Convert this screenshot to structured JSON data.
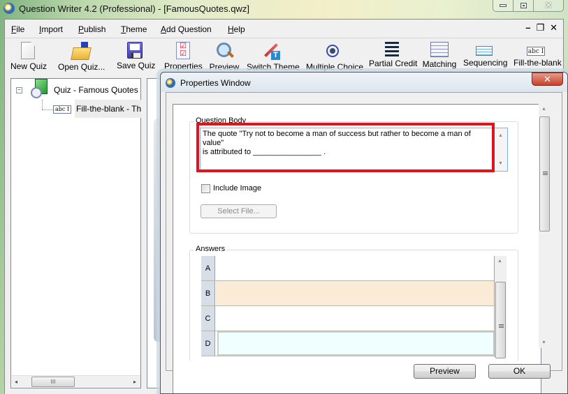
{
  "window": {
    "title": "Question Writer 4.2 (Professional) - [FamousQuotes.qwz]",
    "controls": {
      "minimize": "minimize",
      "maximize": "maximize",
      "close": "✕"
    }
  },
  "menu": [
    {
      "label": "File",
      "accel": "F",
      "rest": "ile"
    },
    {
      "label": "Import",
      "accel": "I",
      "rest": "mport"
    },
    {
      "label": "Publish",
      "accel": "P",
      "rest": "ublish"
    },
    {
      "label": "Theme",
      "accel": "T",
      "rest": "heme"
    },
    {
      "label": "Add Question",
      "accel": "A",
      "rest": "dd Question"
    },
    {
      "label": "Help",
      "accel": "H",
      "rest": "elp"
    }
  ],
  "mdi_controls": {
    "minimize": "–",
    "restore": "❐",
    "close": "✕"
  },
  "toolbar": [
    {
      "label": "New Quiz",
      "icon": "new-document-icon"
    },
    {
      "label": "Open Quiz...",
      "icon": "open-folder-icon"
    },
    {
      "label": "Save Quiz",
      "icon": "floppy-disk-icon"
    },
    {
      "label": "Properties",
      "icon": "checklist-icon"
    },
    {
      "label": "Preview",
      "icon": "magnifier-icon"
    },
    {
      "label": "Switch Theme",
      "icon": "magic-wand-icon"
    },
    {
      "label": "Multiple Choice",
      "icon": "radio-button-icon"
    },
    {
      "label": "Partial Credit",
      "icon": "list-arrows-icon"
    },
    {
      "label": "Matching",
      "icon": "grid-icon"
    },
    {
      "label": "Sequencing",
      "icon": "spinner-list-icon"
    },
    {
      "label": "Fill-the-blank",
      "icon": "text-field-icon",
      "glyph": "abc I"
    }
  ],
  "tree": {
    "root": {
      "label": "Quiz - Famous Quotes",
      "toggle": "−"
    },
    "children": [
      {
        "label": "Fill-the-blank - The quote",
        "glyph": "abc I"
      }
    ],
    "hscroll": {
      "left": "◂",
      "right": "▸",
      "grip": "III"
    }
  },
  "dialog": {
    "title": "Properties Window",
    "close": "✕",
    "question_body": {
      "legend": "Question Body",
      "text": "The quote \"Try not to become a man of success but rather to become a man of value\"\nis attributed to ________________ .",
      "scroll_up": "▲",
      "scroll_down": "▼"
    },
    "include_image": {
      "label": "Include Image",
      "checked": false
    },
    "select_file": "Select File...",
    "answers": {
      "legend": "Answers",
      "rows": [
        {
          "key": "A",
          "value": "",
          "color": "#ffffff"
        },
        {
          "key": "B",
          "value": "",
          "color": "#faebd7"
        },
        {
          "key": "C",
          "value": "",
          "color": "#ffffff"
        },
        {
          "key": "D",
          "value": "",
          "color": "#f0ffff"
        }
      ],
      "scroll_up": "▲"
    },
    "outer_scroll": {
      "up": "▲",
      "down": "▼"
    },
    "buttons": {
      "preview": "Preview",
      "ok": "OK"
    }
  },
  "colors": {
    "highlight": "#e0141e",
    "accent": "#7eb4ea"
  }
}
